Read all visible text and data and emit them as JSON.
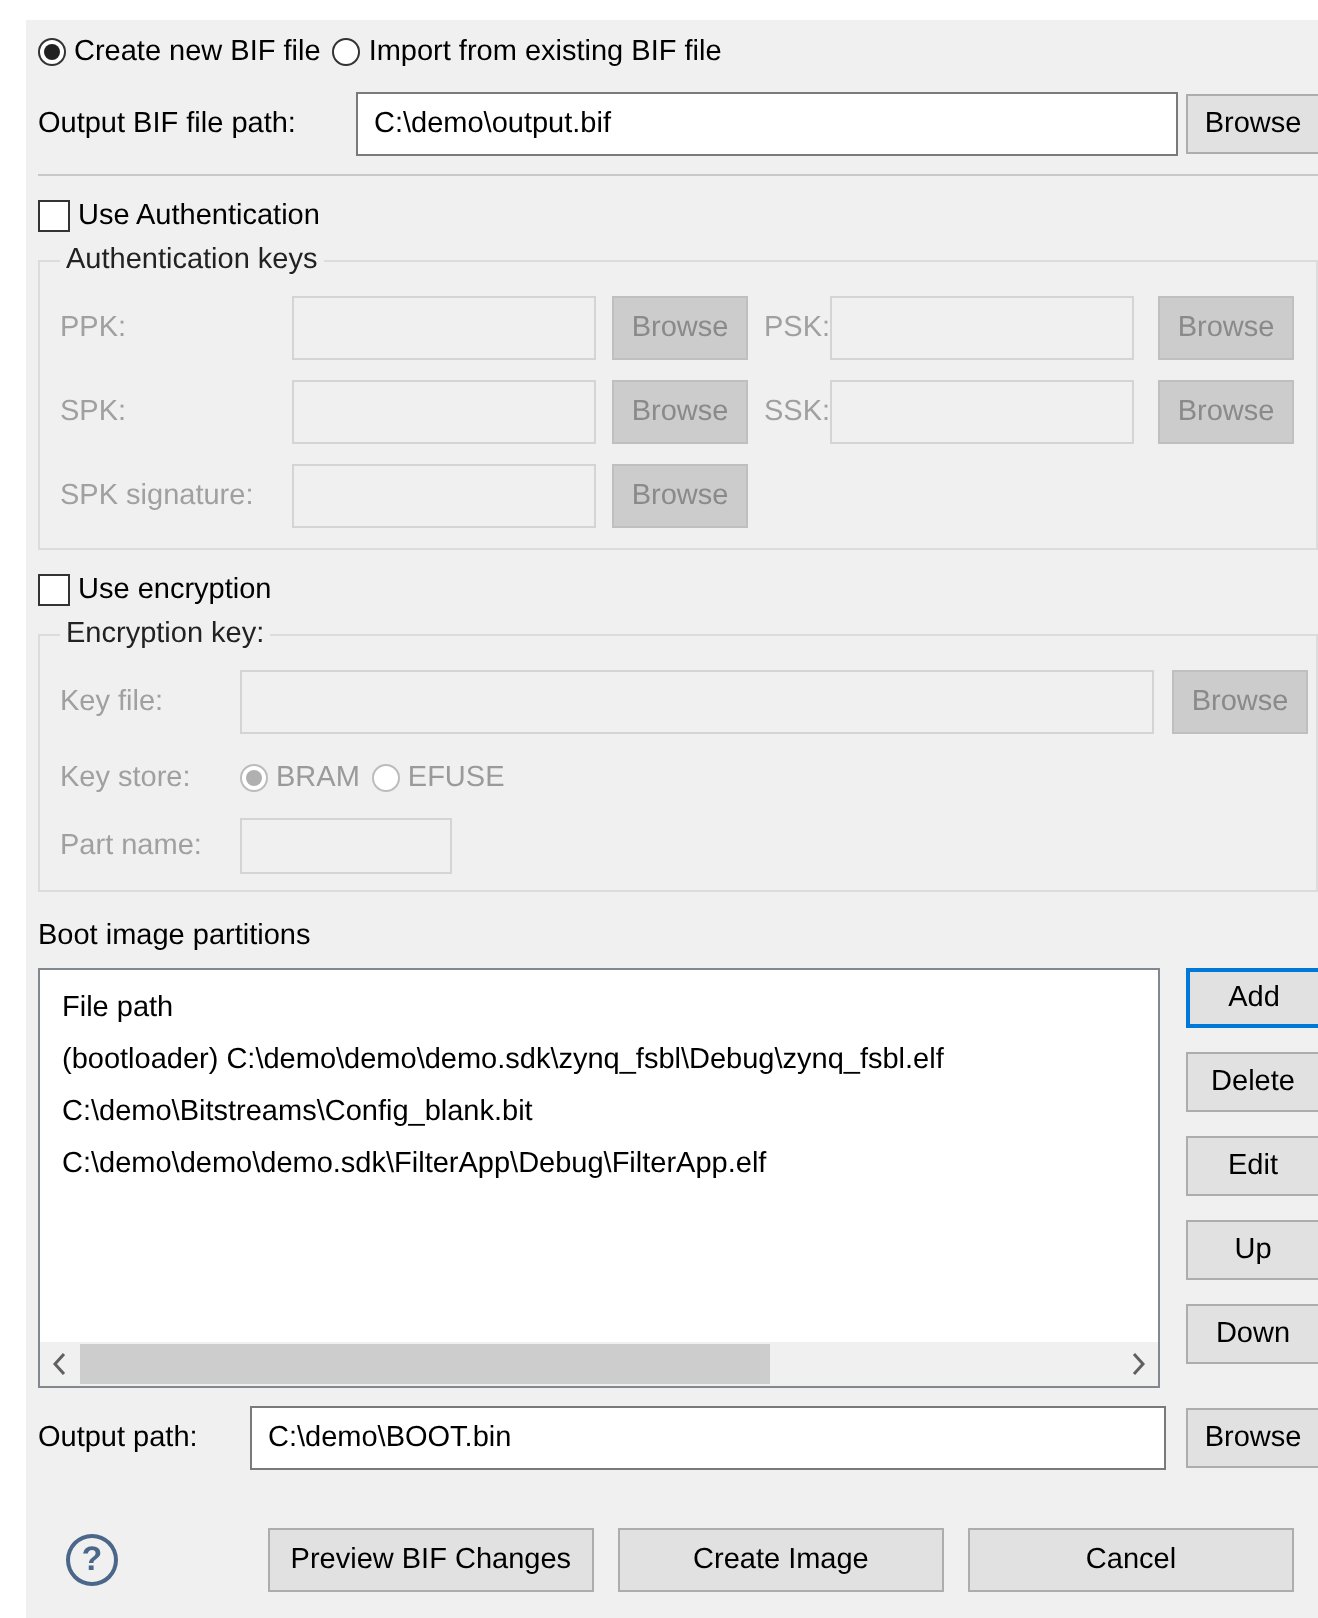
{
  "source_options": [
    {
      "label": "Create new BIF file",
      "selected": true
    },
    {
      "label": "Import from existing BIF file",
      "selected": false
    }
  ],
  "output_bif": {
    "label": "Output BIF file path:",
    "value": "C:\\demo\\output.bif",
    "button": "Browse"
  },
  "authentication": {
    "label": "Use Authentication",
    "checked": false,
    "group_title": "Authentication keys",
    "disabled": true,
    "fields": [
      {
        "label": "PPK:",
        "button": "Browse"
      },
      {
        "label": "PSK:",
        "button": "Browse"
      },
      {
        "label": "SPK:",
        "button": "Browse"
      },
      {
        "label": "SSK:",
        "button": "Browse"
      },
      {
        "label": "SPK signature:",
        "button": "Browse"
      }
    ]
  },
  "encryption": {
    "label": "Use encryption",
    "checked": false,
    "group_title": "Encryption key:",
    "disabled": true,
    "key_file": {
      "label": "Key file:",
      "button": "Browse"
    },
    "key_store": {
      "label": "Key store:",
      "options": [
        {
          "label": "BRAM",
          "selected": true
        },
        {
          "label": "EFUSE",
          "selected": false
        }
      ]
    },
    "part_name": {
      "label": "Part name:"
    }
  },
  "partitions": {
    "title": "Boot image partitions",
    "header": "File path",
    "rows": [
      "(bootloader) C:\\demo\\demo\\demo.sdk\\zynq_fsbl\\Debug\\zynq_fsbl.elf",
      "C:\\demo\\Bitstreams\\Config_blank.bit",
      "C:\\demo\\demo\\demo.sdk\\FilterApp\\Debug\\FilterApp.elf"
    ],
    "buttons": [
      {
        "label": "Add",
        "focused": true
      },
      {
        "label": "Delete",
        "focused": false
      },
      {
        "label": "Edit",
        "focused": false
      },
      {
        "label": "Up",
        "focused": false
      },
      {
        "label": "Down",
        "focused": false
      }
    ]
  },
  "output_path": {
    "label": "Output path:",
    "value": "C:\\demo\\BOOT.bin",
    "button": "Browse"
  },
  "footer": {
    "help": "?",
    "buttons": [
      "Preview BIF Changes",
      "Create Image",
      "Cancel"
    ]
  }
}
